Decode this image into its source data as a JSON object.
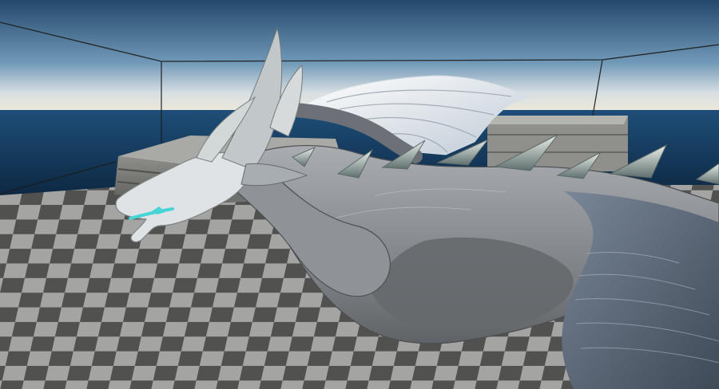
{
  "viewport": {
    "mode": "3d-editor-viewport",
    "has_visible_text": false
  },
  "scene": {
    "subject": "dragon-model",
    "environment": "checkerboard-floor-with-sky-and-ocean",
    "colors": {
      "sky_top": "#2a4d6f",
      "sky_horizon": "#e7e8e0",
      "ocean": "#123a5c",
      "floor_light": "#b6b6b3",
      "floor_dark": "#5a5a58",
      "dragon_body": "#8e9194",
      "dragon_highlight": "#d7dbdf",
      "wing_membrane": "#e9eef4",
      "eye_glow": "#47d4d4"
    }
  }
}
